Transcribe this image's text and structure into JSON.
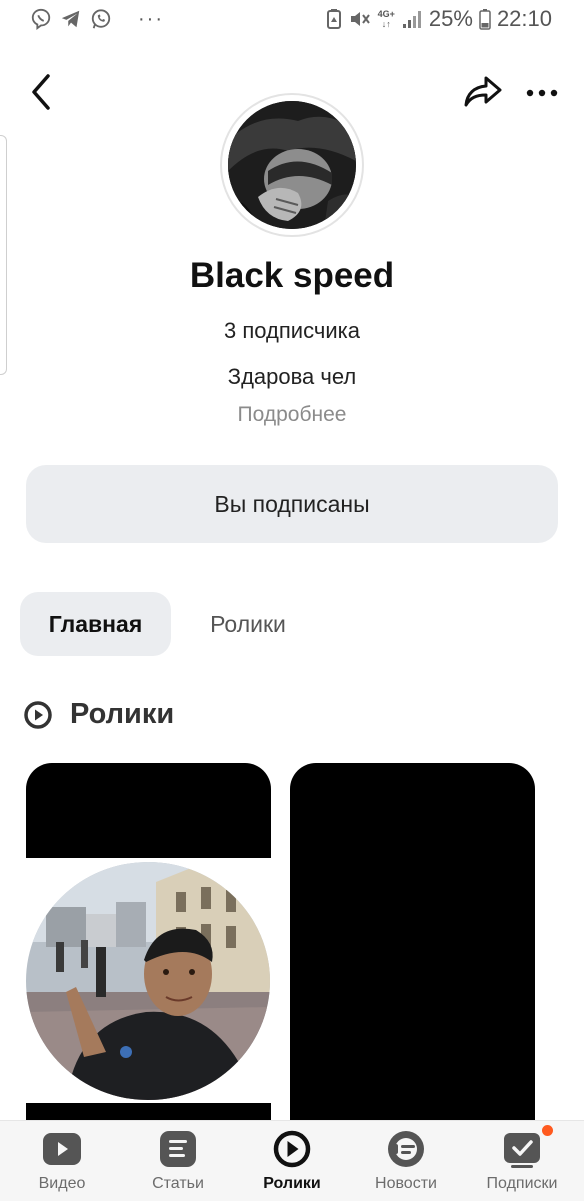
{
  "status_bar": {
    "left_icons": [
      "viber-icon",
      "telegram-icon",
      "whatsapp-icon"
    ],
    "overflow": "···",
    "network": "4G+",
    "battery": "25%",
    "time": "22:10"
  },
  "header": {
    "back_icon": "chevron-left-icon",
    "share_icon": "share-icon",
    "more_icon": "more-horizontal-icon"
  },
  "channel": {
    "name": "Black speed",
    "subscribers": "3 подписчика",
    "description": "Здарова чел",
    "more_link": "Подробнее",
    "subscribe_button": "Вы подписаны"
  },
  "tabs": [
    {
      "label": "Главная",
      "active": true
    },
    {
      "label": "Ролики",
      "active": false
    }
  ],
  "section": {
    "icon": "play-circle-icon",
    "title": "Ролики"
  },
  "bottom_nav": [
    {
      "label": "Видео",
      "icon": "video-icon",
      "active": false
    },
    {
      "label": "Статьи",
      "icon": "article-icon",
      "active": false
    },
    {
      "label": "Ролики",
      "icon": "clips-icon",
      "active": true
    },
    {
      "label": "Новости",
      "icon": "news-icon",
      "active": false
    },
    {
      "label": "Подписки",
      "icon": "subscriptions-icon",
      "active": false,
      "badge": true
    }
  ],
  "colors": {
    "accent_badge": "#ff5a1f",
    "pill_bg": "#ebedf0",
    "muted_text": "#8b8b8b"
  }
}
